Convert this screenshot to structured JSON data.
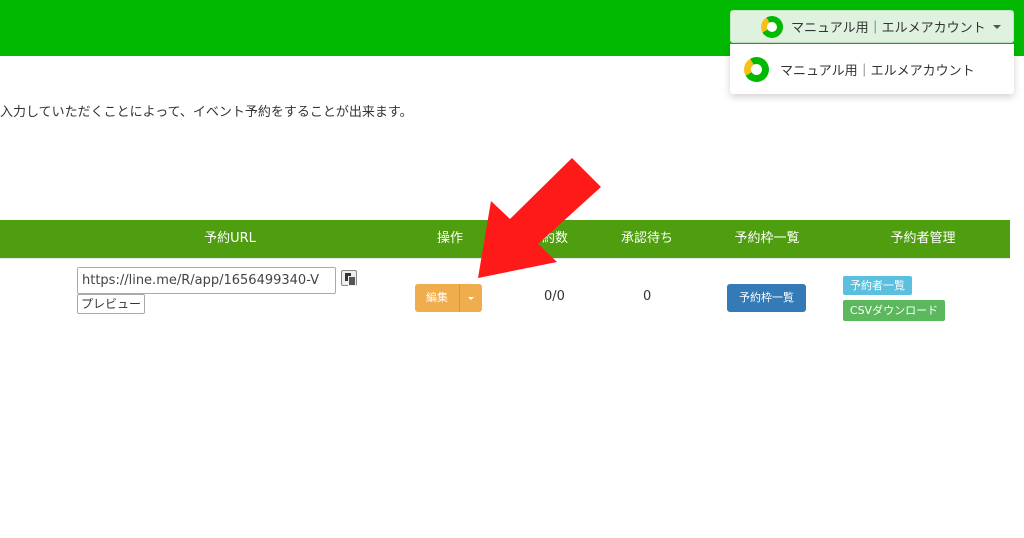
{
  "header": {
    "account_label": "マニュアル用｜エルメアカウント",
    "dropdown_item_label": "マニュアル用｜エルメアカウント",
    "bar_color": "#00b900"
  },
  "intro_text": "入力していただくことによって、イベント予約をすることが出来ます。",
  "table": {
    "columns": [
      "予約URL",
      "操作",
      "約数",
      "承認待ち",
      "予約枠一覧",
      "予約者管理"
    ],
    "header_color": "#4e9e0f",
    "row": {
      "url_value": "https://line.me/R/app/1656499340-V",
      "preview_label": "プレビュー",
      "edit_label": "編集",
      "count": "0/0",
      "pending": "0",
      "slot_list_label": "予約枠一覧",
      "reserver_list_label": "予約者一覧",
      "csv_download_label": "CSVダウンロード"
    }
  },
  "icons": [
    "account-logo-icon",
    "chevron-down-icon",
    "copy-icon",
    "caret-down-icon",
    "red-arrow-icon"
  ],
  "colors": {
    "edit": "#f0ad4e",
    "primary": "#337ab7",
    "info": "#5bc0de",
    "success": "#5cb85c",
    "arrow": "#ff1a1a"
  }
}
